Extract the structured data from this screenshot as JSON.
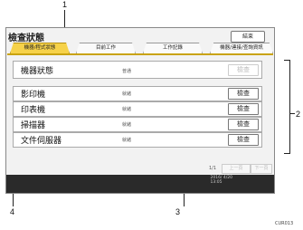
{
  "callouts": [
    "1",
    "2",
    "3",
    "4"
  ],
  "window": {
    "title": "檢查狀態",
    "end_label": "結束"
  },
  "tabs": [
    {
      "label": "機器/程式狀態",
      "active": true
    },
    {
      "label": "目前工作"
    },
    {
      "label": "工作記錄"
    },
    {
      "label": "機器/連接/查詢資訊"
    }
  ],
  "rows": [
    {
      "label": "機器狀態",
      "status": "普通",
      "button": "檢查",
      "disabled": true
    },
    {
      "label": "影印機",
      "status": "就緒",
      "button": "檢查"
    },
    {
      "label": "印表機",
      "status": "就緒",
      "button": "檢查"
    },
    {
      "label": "掃描器",
      "status": "就緒",
      "button": "檢查"
    },
    {
      "label": "文件伺服器",
      "status": "就緒",
      "button": "檢查"
    }
  ],
  "pager": {
    "text": "1/1",
    "prev": "上一頁",
    "next": "下一頁"
  },
  "datetime": {
    "date": "2016/ 4/20",
    "time": "13:05"
  },
  "figure_code": "CUR013"
}
